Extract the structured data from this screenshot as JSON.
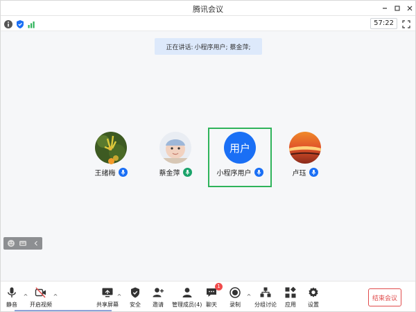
{
  "window": {
    "title": "腾讯会议"
  },
  "status": {
    "timer": "57:22"
  },
  "speaking": {
    "prefix": "正在讲话:",
    "speakers": "小程序用户; 蔡金萍;"
  },
  "participants": [
    {
      "name": "王绪梅",
      "mic_color": "#1a6ff5",
      "active": false
    },
    {
      "name": "蔡金萍",
      "mic_color": "#1aa36a",
      "active": false
    },
    {
      "name": "小程序用户",
      "avatar_text": "用户",
      "mic_color": "#1a6ff5",
      "active": true
    },
    {
      "name": "卢珏",
      "mic_color": "#1a6ff5",
      "active": false
    }
  ],
  "toolbar": {
    "mute": "静音",
    "video": "开启视频",
    "share": "共享屏幕",
    "security": "安全",
    "invite": "邀请",
    "members": "管理成员(4)",
    "chat": "聊天",
    "chat_badge": "1",
    "record": "录制",
    "breakout": "分组讨论",
    "apps": "应用",
    "settings": "设置",
    "end": "结束会议"
  },
  "colors": {
    "accent": "#1a6ff5",
    "active_border": "#2eb35a",
    "danger": "#e04a4a",
    "banner": "#dde9fb"
  }
}
